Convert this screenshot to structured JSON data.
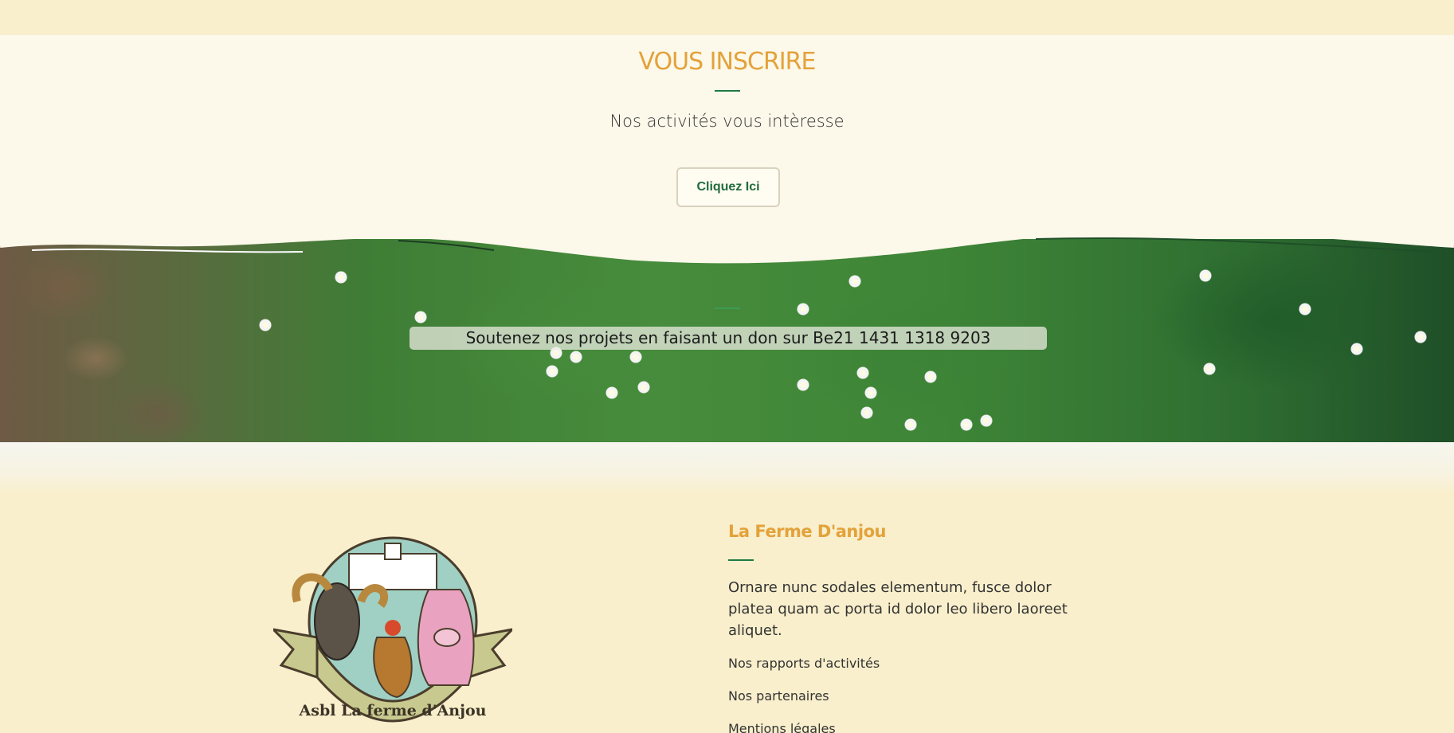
{
  "signup": {
    "title": "VOUS INSCRIRE",
    "subtitle": "Nos activités vous intèresse",
    "button_label": "Cliquez Ici"
  },
  "donation": {
    "text": "Soutenez nos projets en faisant un don sur Be21 1431 1318 9203"
  },
  "footer": {
    "logo_text": "Asbl La ferme d'Anjou",
    "title": "La Ferme D'anjou",
    "description": "Ornare nunc sodales elementum, fusce dolor platea quam ac porta id dolor leo libero laoreet aliquet.",
    "links": [
      "Nos rapports d'activités",
      "Nos partenaires",
      "Mentions légales"
    ]
  },
  "colors": {
    "accent_orange": "#e3a23a",
    "accent_green": "#1f7a43",
    "background_cream": "#fcf8ea",
    "footer_bg": "#f9efcc"
  }
}
